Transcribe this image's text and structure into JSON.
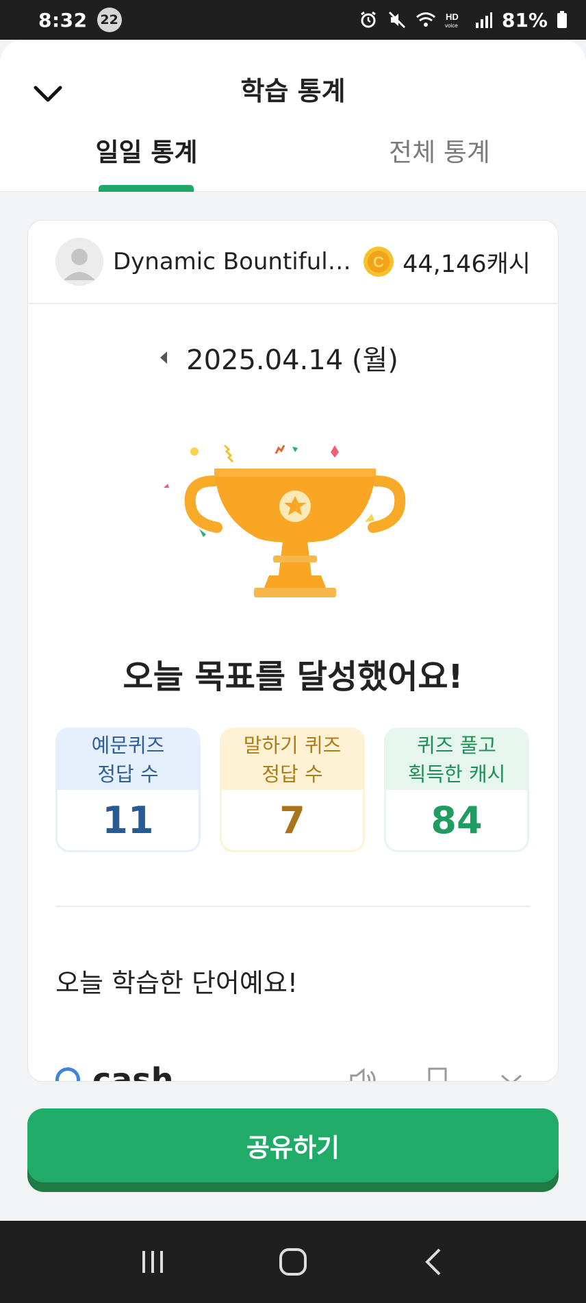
{
  "status_bar": {
    "time": "8:32",
    "notification_count": "22",
    "battery": "81%",
    "icons": [
      "alarm-icon",
      "mute-icon",
      "wifi-icon",
      "hd-voice-icon",
      "signal-icon",
      "battery-icon"
    ]
  },
  "header": {
    "title": "학습 통계",
    "tabs": [
      {
        "label": "일일 통계",
        "selected": true
      },
      {
        "label": "전체 통계",
        "selected": false
      }
    ]
  },
  "profile": {
    "name": "Dynamic Bountiful Jaguar",
    "cash": "44,146캐시"
  },
  "date": {
    "label": "2025.04.14 (월)"
  },
  "goal": {
    "message": "오늘 목표를 달성했어요!"
  },
  "stats": [
    {
      "label_line1": "예문퀴즈",
      "label_line2": "정답 수",
      "value": "11"
    },
    {
      "label_line1": "말하기 퀴즈",
      "label_line2": "정답 수",
      "value": "7"
    },
    {
      "label_line1": "퀴즈 풀고",
      "label_line2": "획득한 캐시",
      "value": "84"
    }
  ],
  "words": {
    "title": "오늘 학습한 단어예요!",
    "items": [
      {
        "word": "cash"
      }
    ]
  },
  "share_button": {
    "label": "공유하기"
  },
  "colors": {
    "accent_green": "#21ab68",
    "stat_blue": "#275b94",
    "stat_yellow": "#a9741b",
    "stat_green": "#1f9c61",
    "trophy": "#f7a928"
  }
}
